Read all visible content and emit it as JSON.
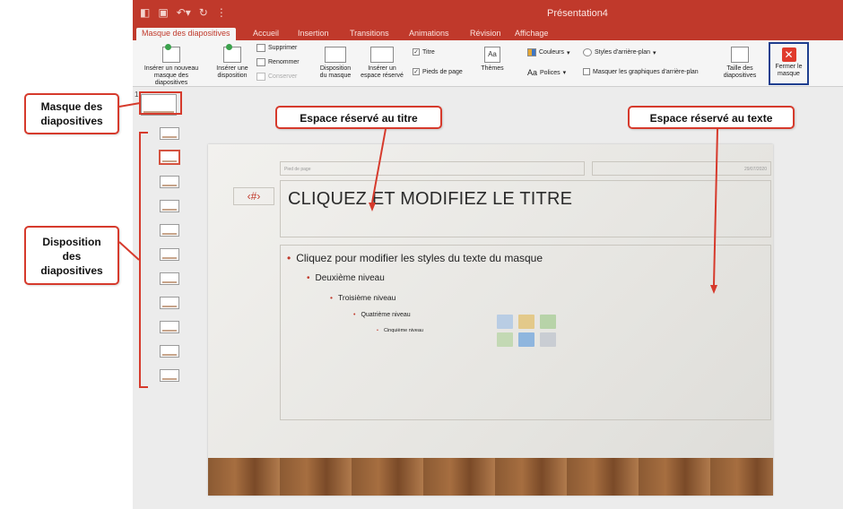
{
  "window": {
    "title": "Présentation4"
  },
  "quick_access": {
    "icons": [
      "sidebar-icon",
      "save-icon",
      "undo-icon",
      "redo-icon",
      "customize-icon"
    ]
  },
  "tabs": [
    {
      "label": "Masque des diapositives",
      "active": true
    },
    {
      "label": "Accueil"
    },
    {
      "label": "Insertion"
    },
    {
      "label": "Transitions"
    },
    {
      "label": "Animations"
    },
    {
      "label": "Révision"
    },
    {
      "label": "Affichage"
    }
  ],
  "ribbon": {
    "insert_master": "Insérer un nouveau\nmasque des diapositives",
    "insert_layout": "Insérer une\ndisposition",
    "delete": "Supprimer",
    "rename": "Renommer",
    "preserve": "Conserver",
    "master_layout": "Disposition\ndu masque",
    "insert_placeholder": "Insérer un\nespace réservé",
    "title_check": "Titre",
    "footers_check": "Pieds de page",
    "themes": "Thèmes",
    "colors": "Couleurs",
    "fonts": "Polices",
    "background_styles": "Styles d'arrière-plan",
    "hide_background": "Masquer les graphiques d'arrière-plan",
    "slide_size": "Taille des\ndiapositives",
    "close_master": "Fermer le\nmasque"
  },
  "thumbnails": {
    "slide_number": "1"
  },
  "slide": {
    "footer": "Pied de page",
    "date": "29/07/2020",
    "slide_number": "‹#›",
    "title": "CLIQUEZ ET MODIFIEZ LE TITRE",
    "levels": [
      "Cliquez pour modifier les styles du texte du masque",
      "Deuxième niveau",
      "Troisième niveau",
      "Quatrième niveau",
      "Cinquième niveau"
    ]
  },
  "callouts": {
    "master": "Masque des\ndiapositives",
    "layouts": "Disposition\ndes\ndiapositives",
    "title_placeholder": "Espace réservé au titre",
    "text_placeholder": "Espace réservé au texte"
  },
  "colors": {
    "ribbon": "#c0392b",
    "accent": "#d63a2c",
    "close_border": "#1f3f8f"
  }
}
